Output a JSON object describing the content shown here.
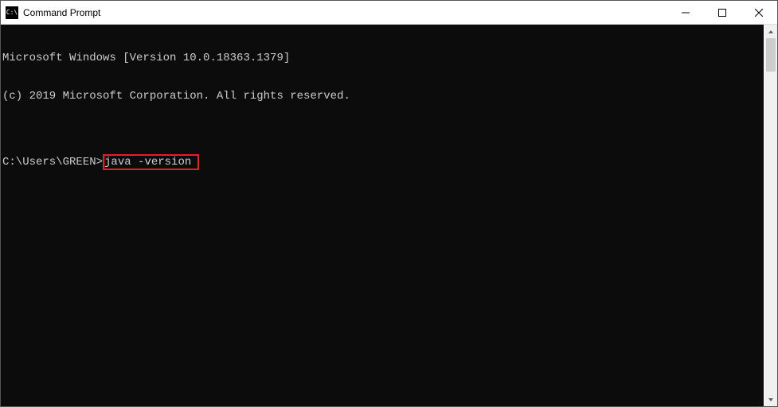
{
  "window": {
    "title": "Command Prompt"
  },
  "terminal": {
    "line1": "Microsoft Windows [Version 10.0.18363.1379]",
    "line2": "(c) 2019 Microsoft Corporation. All rights reserved.",
    "blank": "",
    "prompt": "C:\\Users\\GREEN>",
    "command": "java -version"
  }
}
